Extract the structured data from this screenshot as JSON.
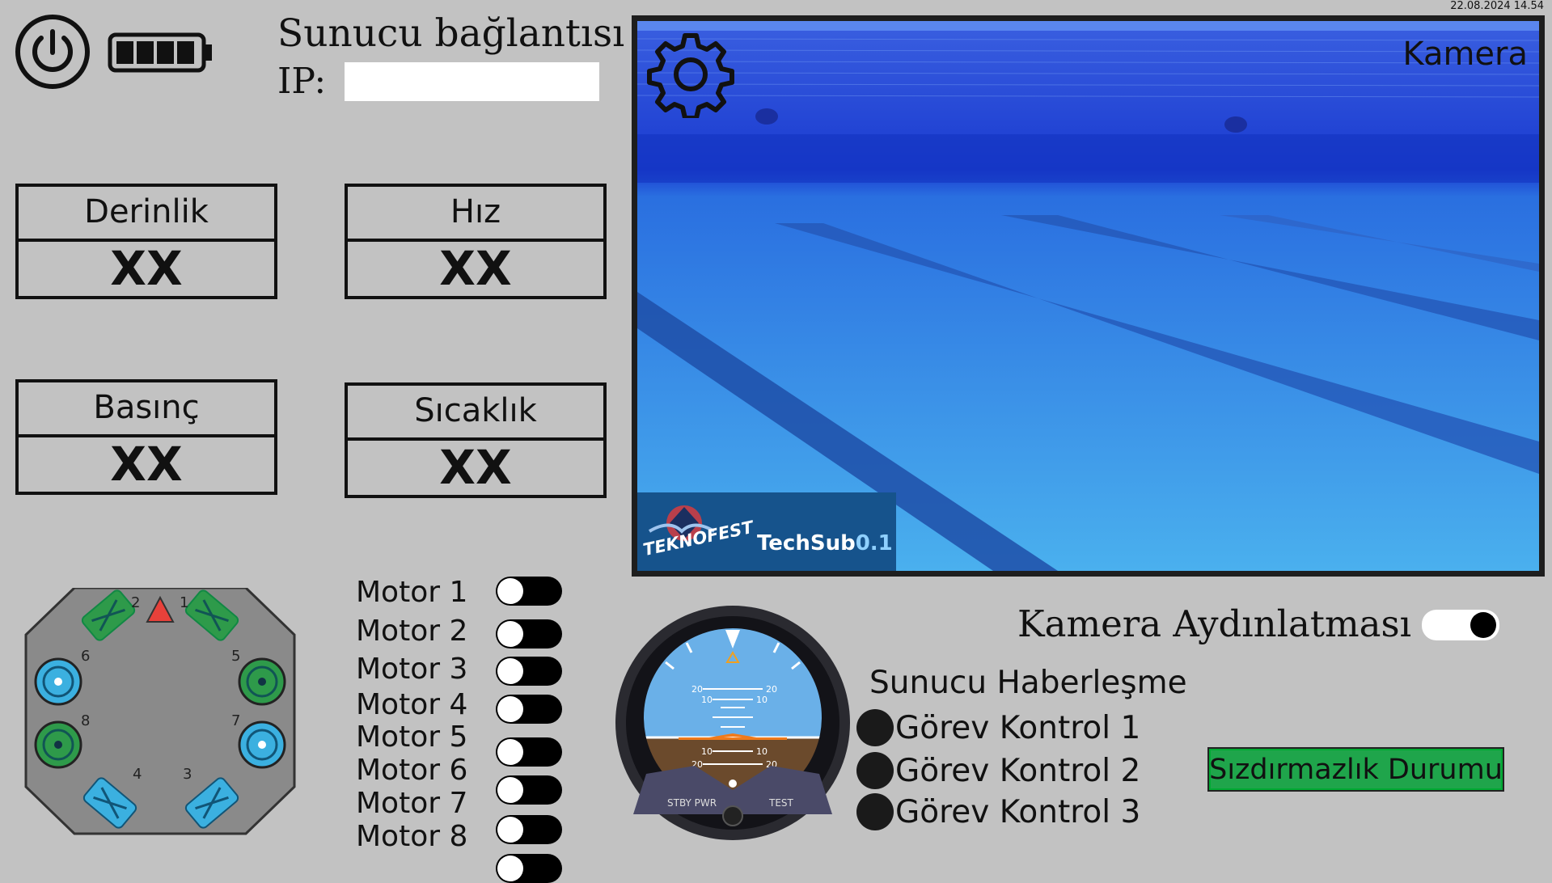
{
  "datetime": "22.08.2024 14.54",
  "server": {
    "title": "Sunucu bağlantısı",
    "ip_label": "IP:",
    "ip_value": ""
  },
  "sensors": {
    "depth": {
      "label": "Derinlik",
      "value": "XX"
    },
    "speed": {
      "label": "Hız",
      "value": "XX"
    },
    "pressure": {
      "label": "Basınç",
      "value": "XX"
    },
    "temperature": {
      "label": "Sıcaklık",
      "value": "XX"
    }
  },
  "camera": {
    "label": "Kamera",
    "logo_left": "TEKNOFEST",
    "logo_right": "TechSub",
    "logo_version": "0.1"
  },
  "motors": [
    {
      "label": "Motor 1",
      "on": false
    },
    {
      "label": "Motor 2",
      "on": false
    },
    {
      "label": "Motor 3",
      "on": false
    },
    {
      "label": "Motor 4",
      "on": false
    },
    {
      "label": "Motor 5",
      "on": false
    },
    {
      "label": "Motor 6",
      "on": false
    },
    {
      "label": "Motor 7",
      "on": false
    },
    {
      "label": "Motor 8",
      "on": false
    }
  ],
  "diagram_numbers": [
    "1",
    "2",
    "3",
    "4",
    "5",
    "6",
    "7",
    "8"
  ],
  "attitude": {
    "stby": "STBY PWR",
    "test": "TEST",
    "p20": "20",
    "p10": "10"
  },
  "camera_light": {
    "label": "Kamera Aydınlatması",
    "on": true
  },
  "comms": {
    "title": "Sunucu Haberleşme",
    "tasks": [
      "Görev Kontrol 1",
      "Görev Kontrol 2",
      "Görev Kontrol 3"
    ]
  },
  "seal_button": "Sızdırmazlık Durumu",
  "colors": {
    "background": "#c2c2c2",
    "seal_green": "#1fa54b",
    "water": "#2f7fe0",
    "thruster_green": "#2e9a4a",
    "thruster_blue": "#3bb0e0"
  }
}
